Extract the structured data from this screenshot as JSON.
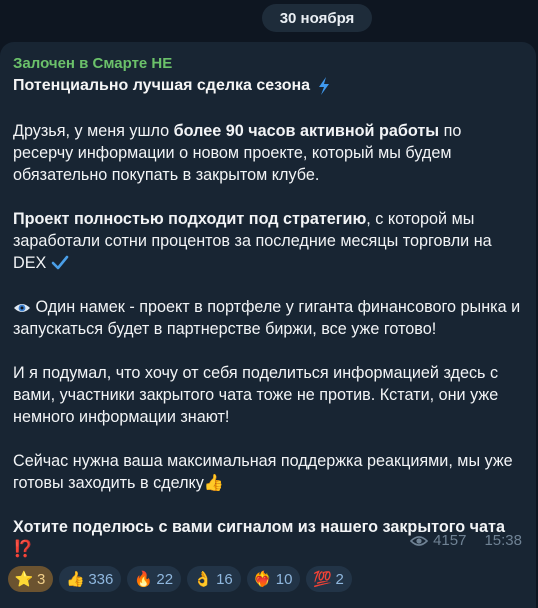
{
  "date_label": "30 ноября",
  "message": {
    "forwarded_from": "Залочен в Смарте НЕ",
    "title": "Потенциально лучшая сделка сезона",
    "p1_a": "Друзья, у меня ушло ",
    "p1_b": "более 90 часов активной работы",
    "p1_c": " по ресерчу информации о новом проекте, который мы будем обязательно покупать в закрытом клубе.",
    "p2_a": "Проект полностью подходит под стратегию",
    "p2_b": ", с которой мы заработали сотни процентов за последние месяцы торговли на DEX",
    "p3": "Один намек - проект в портфеле у гиганта финансового рынка и запускаться будет в партнерстве биржи, все уже готово!",
    "p4": "И я подумал, что хочу от себя поделиться информацией здесь с вами, участники закрытого чата тоже не против. Кстати, они уже немного информации знают!",
    "p5": "Сейчас нужна ваша максимальная поддержка реакциями, мы уже готовы заходить в сделку",
    "p6": "Хотите поделюсь с вами сигналом из нашего закрытого чата",
    "p6_emoji": "⁉️"
  },
  "reactions": [
    {
      "emoji": "⭐",
      "count": "3",
      "icon": "star-icon"
    },
    {
      "emoji": "👍",
      "count": "336",
      "icon": "thumbs-up-icon"
    },
    {
      "emoji": "🔥",
      "count": "22",
      "icon": "fire-icon"
    },
    {
      "emoji": "👌",
      "count": "16",
      "icon": "ok-hand-icon"
    },
    {
      "emoji": "❤️‍🔥",
      "count": "10",
      "icon": "heart-on-fire-icon"
    },
    {
      "emoji": "💯",
      "count": "2",
      "icon": "hundred-points-icon"
    }
  ],
  "views": "4157",
  "time": "15:38",
  "colors": {
    "background": "#0e1621",
    "bubble": "#182533",
    "forward_name": "#6bc16a",
    "accent": "#4a9fe8"
  }
}
